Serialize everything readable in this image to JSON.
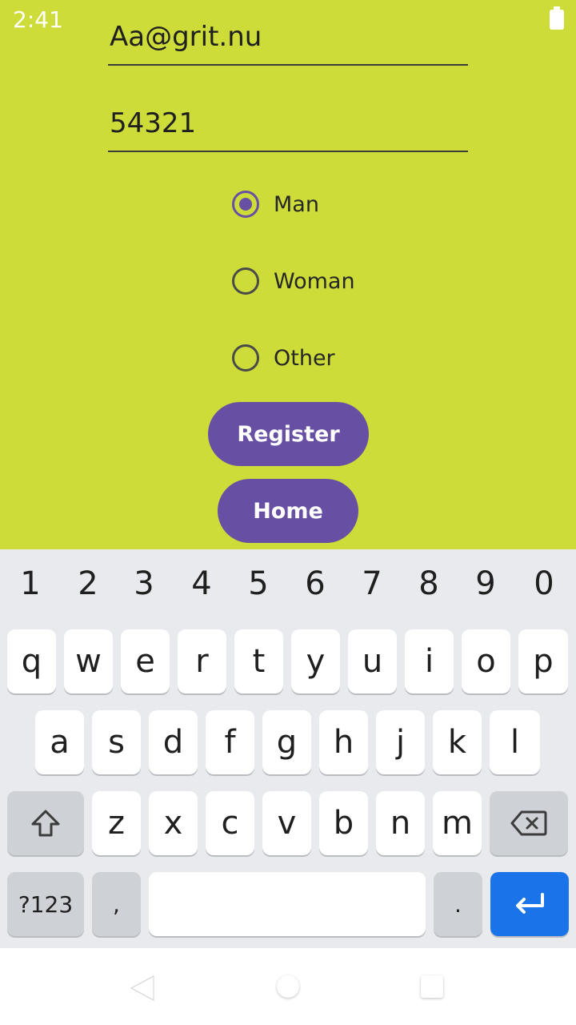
{
  "status_bar": {
    "time": "2:41"
  },
  "form": {
    "email_value": "Aa@grit.nu",
    "password_value": "54321",
    "gender_options": [
      {
        "label": "Man",
        "checked": true
      },
      {
        "label": "Woman",
        "checked": false
      },
      {
        "label": "Other",
        "checked": false
      }
    ],
    "register_label": "Register",
    "home_label": "Home"
  },
  "keyboard": {
    "number_row": [
      "1",
      "2",
      "3",
      "4",
      "5",
      "6",
      "7",
      "8",
      "9",
      "0"
    ],
    "row1": [
      "q",
      "w",
      "e",
      "r",
      "t",
      "y",
      "u",
      "i",
      "o",
      "p"
    ],
    "row2": [
      "a",
      "s",
      "d",
      "f",
      "g",
      "h",
      "j",
      "k",
      "l"
    ],
    "row3": [
      "z",
      "x",
      "c",
      "v",
      "b",
      "n",
      "m"
    ],
    "symbols_label": "?123",
    "comma_label": ",",
    "period_label": "."
  },
  "colors": {
    "background": "#CEDC3A",
    "accent": "#6750A4",
    "enter_key": "#1A73E8"
  }
}
